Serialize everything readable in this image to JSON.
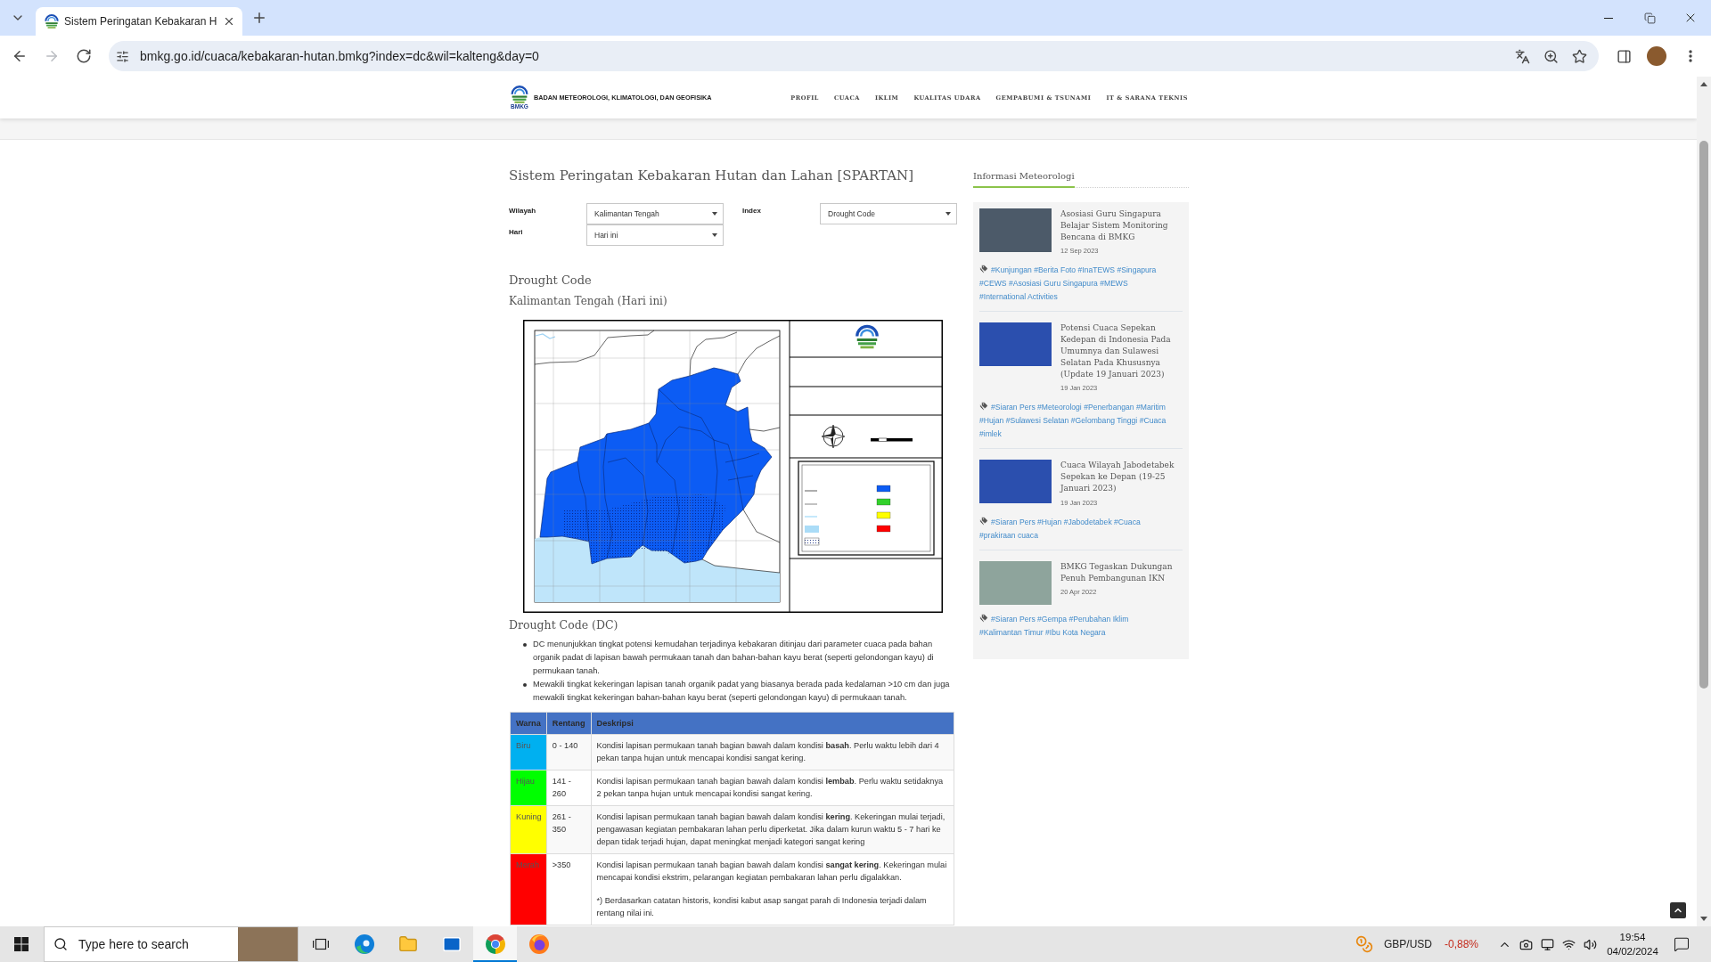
{
  "browser": {
    "tab": {
      "title": "Sistem Peringatan Kebakaran H"
    },
    "nav_buttons": [
      {
        "kind": "back",
        "disabled": false
      },
      {
        "kind": "forward",
        "disabled": true
      },
      {
        "kind": "reload",
        "disabled": false
      }
    ],
    "url": "bmkg.go.id/cuaca/kebakaran-hutan.bmkg?index=dc&wil=kalteng&day=0"
  },
  "site_header": {
    "logo_caption": "BMKG",
    "org_name": "BADAN METEOROLOGI, KLIMATOLOGI, DAN GEOFISIKA",
    "nav": [
      "PROFIL",
      "CUACA",
      "IKLIM",
      "KUALITAS UDARA",
      "GEMPABUMI & TSUNAMI",
      "IT & SARANA TEKNIS"
    ]
  },
  "main": {
    "title": "Sistem Peringatan Kebakaran Hutan dan Lahan [SPARTAN]",
    "filters": [
      {
        "label": "Wilayah",
        "value": "Kalimantan Tengah"
      },
      {
        "label": "Index",
        "value": "Drought Code"
      },
      {
        "label": "Hari",
        "value": "Hari ini"
      }
    ],
    "section_title": "Drought Code",
    "subtitle": "Kalimantan Tengah (Hari ini)",
    "info_title": "Drought Code (DC)",
    "bullets": [
      "DC menunjukkan tingkat potensi kemudahan terjadinya kebakaran ditinjau dari parameter cuaca pada bahan organik padat di lapisan bawah permukaan tanah dan bahan-bahan kayu berat (seperti gelondongan kayu) di permukaan tanah.",
      "Mewakili tingkat kekeringan lapisan tanah organik padat yang biasanya berada pada kedalaman >10 cm dan juga mewakili tingkat kekeringan bahan-bahan kayu berat (seperti gelondongan kayu) di permukaan tanah."
    ],
    "table": {
      "columns": [
        "Warna",
        "Rentang",
        "Deskripsi"
      ],
      "rows": [
        {
          "color": "#00b0f0",
          "warna": "Biru",
          "rentang": "0 - 140",
          "deskripsi": "Kondisi lapisan permukaan tanah bagian bawah dalam kondisi **basah**. Perlu waktu lebih dari 4 pekan tanpa hujan untuk mencapai kondisi sangat kering."
        },
        {
          "color": "#00ff00",
          "warna": "Hijau",
          "rentang": "141 - 260",
          "deskripsi": "Kondisi lapisan permukaan tanah bagian bawah dalam kondisi **lembab**. Perlu waktu setidaknya 2 pekan tanpa hujan untuk mencapai kondisi sangat kering."
        },
        {
          "color": "#ffff00",
          "warna": "Kuning",
          "rentang": "261 - 350",
          "deskripsi": "Kondisi lapisan permukaan tanah bagian bawah dalam kondisi **kering**. Kekeringan mulai terjadi, pengawasan kegiatan pembakaran lahan perlu diperketat. Jika dalam kurun waktu 5 - 7 hari ke depan tidak terjadi hujan, dapat meningkat menjadi kategori sangat kering"
        },
        {
          "color": "#ff0000",
          "warna": "Merah",
          "rentang": ">350",
          "deskripsi": "Kondisi lapisan permukaan tanah bagian bawah dalam kondisi **sangat kering**. Kekeringan mulai mencapai kondisi ekstrim, pelarangan kegiatan pembakaran lahan perlu digalakkan.",
          "note": "*) Berdasarkan catatan historis, kondisi kabut asap sangat parah di Indonesia terjadi dalam rentang nilai ini."
        }
      ]
    }
  },
  "sidebar": {
    "title": "Informasi Meteorologi",
    "articles": [
      {
        "title": "Asosiasi Guru Singapura Belajar Sistem Monitoring Bencana di BMKG",
        "date": "12 Sep 2023",
        "tags": [
          "#Kunjungan",
          "#Berita Foto",
          "#InaTEWS",
          "#Singapura",
          "#CEWS",
          "#Asosiasi Guru Singapura",
          "#MEWS",
          "#International Activities"
        ]
      },
      {
        "title": "Potensi Cuaca Sepekan Kedepan di Indonesia Pada Umumnya dan Sulawesi Selatan Pada Khususnya (Update 19 Januari 2023)",
        "date": "19 Jan 2023",
        "tags": [
          "#Siaran Pers",
          "#Meteorologi",
          "#Penerbangan",
          "#Maritim",
          "#Hujan",
          "#Sulawesi Selatan",
          "#Gelombang Tinggi",
          "#Cuaca",
          "#imlek"
        ]
      },
      {
        "title": "Cuaca Wilayah Jabodetabek Sepekan ke Depan (19-25 Januari 2023)",
        "date": "19 Jan 2023",
        "tags": [
          "#Siaran Pers",
          "#Hujan",
          "#Jabodetabek",
          "#Cuaca",
          "#prakiraan cuaca"
        ]
      },
      {
        "title": "BMKG Tegaskan Dukungan Penuh Pembangunan IKN",
        "date": "20 Apr 2022",
        "tags": [
          "#Siaran Pers",
          "#Gempa",
          "#Perubahan Iklim",
          "#Kalimantan Timur",
          "#Ibu Kota Negara"
        ]
      }
    ]
  },
  "taskbar": {
    "search": {
      "placeholder": "Type here to search"
    },
    "apps": [
      {
        "kind": "task_view",
        "selected": false
      },
      {
        "kind": "edge",
        "selected": false
      },
      {
        "kind": "files",
        "selected": false
      },
      {
        "kind": "mail",
        "selected": false
      },
      {
        "kind": "chrome",
        "selected": true
      },
      {
        "kind": "firefox",
        "selected": false
      }
    ],
    "ticker": {
      "symbol": "GBP/USD",
      "change": "-0,88%"
    },
    "time": "19:54",
    "date": "04/02/2024"
  }
}
